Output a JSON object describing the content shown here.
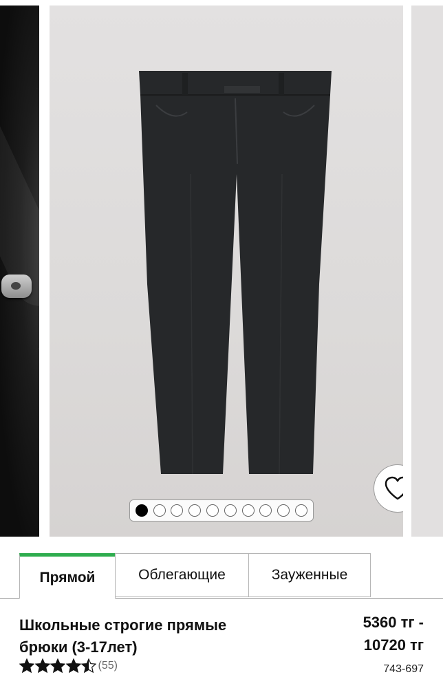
{
  "carousel": {
    "dots_total": 10,
    "active_dot_index": 0,
    "wishlist_icon": "heart-icon"
  },
  "fit_tabs": [
    {
      "label": "Прямой",
      "active": true
    },
    {
      "label": "Облегающие",
      "active": false
    },
    {
      "label": "Зауженные",
      "active": false
    }
  ],
  "product": {
    "title_line1": "Школьные строгие прямые",
    "title_line2": "брюки (3-17лет)",
    "price_line1": "5360 тг -",
    "price_line2": "10720 тг",
    "rating": 4.5,
    "reviews_count": "(55)",
    "code": "743-697"
  },
  "colors": {
    "active_tab_accent": "#2eac4e",
    "pants": "#26282a",
    "background": "#dcdad9"
  }
}
